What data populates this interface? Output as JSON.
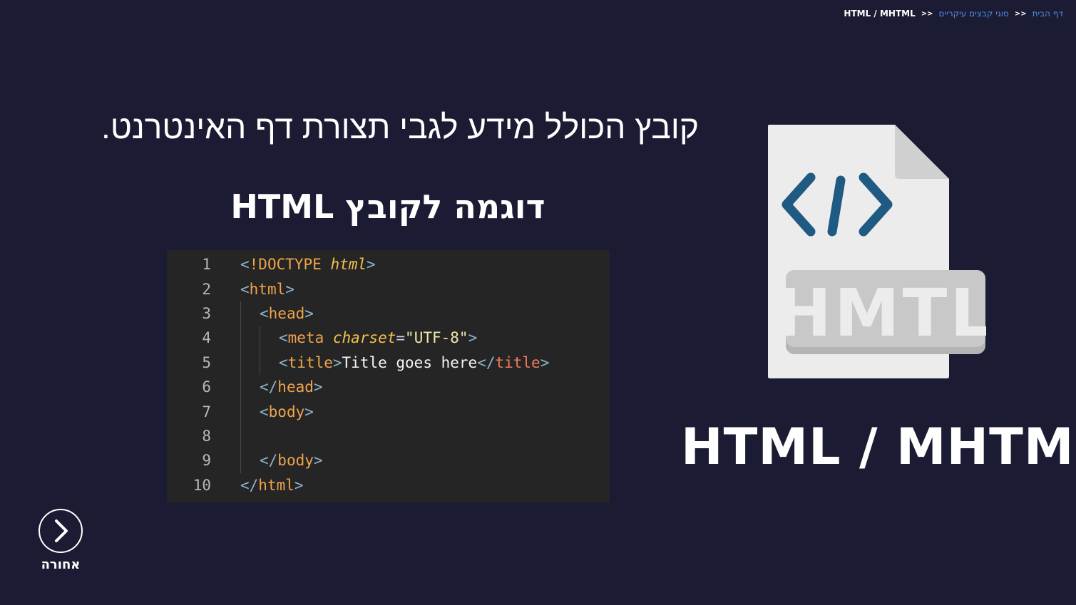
{
  "breadcrumb": {
    "home": "דף הבית",
    "category": "סוגי קבצים עיקריים",
    "current": "HTML / MHTML",
    "separator": "<<"
  },
  "description": "קובץ הכולל מידע לגבי תצורת דף האינטרנט.",
  "example_heading": "דוגמה לקובץ HTML",
  "code": {
    "line_numbers": [
      "1",
      "2",
      "3",
      "4",
      "5",
      "6",
      "7",
      "8",
      "9",
      "10"
    ],
    "lines": [
      {
        "indent": 0,
        "tokens": [
          {
            "c": "t-punct",
            "t": "<"
          },
          {
            "c": "t-doc",
            "t": "!DOCTYPE "
          },
          {
            "c": "t-kw",
            "t": "html"
          },
          {
            "c": "t-punct",
            "t": ">"
          }
        ]
      },
      {
        "indent": 0,
        "tokens": [
          {
            "c": "t-punct",
            "t": "<"
          },
          {
            "c": "t-tag",
            "t": "html"
          },
          {
            "c": "t-punct",
            "t": ">"
          }
        ]
      },
      {
        "indent": 1,
        "tokens": [
          {
            "c": "t-punct",
            "t": "<"
          },
          {
            "c": "t-tag",
            "t": "head"
          },
          {
            "c": "t-punct",
            "t": ">"
          }
        ]
      },
      {
        "indent": 2,
        "tokens": [
          {
            "c": "t-punct",
            "t": "<"
          },
          {
            "c": "t-tag",
            "t": "meta "
          },
          {
            "c": "t-attr",
            "t": "charset"
          },
          {
            "c": "t-eq",
            "t": "="
          },
          {
            "c": "t-str",
            "t": "\"UTF-8\""
          },
          {
            "c": "t-punct",
            "t": ">"
          }
        ]
      },
      {
        "indent": 2,
        "tokens": [
          {
            "c": "t-punct",
            "t": "<"
          },
          {
            "c": "t-tag",
            "t": "title"
          },
          {
            "c": "t-punct",
            "t": ">"
          },
          {
            "c": "t-text",
            "t": "Title goes here"
          },
          {
            "c": "t-punct",
            "t": "</"
          },
          {
            "c": "t-title-close",
            "t": "title"
          },
          {
            "c": "t-punct",
            "t": ">"
          }
        ]
      },
      {
        "indent": 1,
        "tokens": [
          {
            "c": "t-punct",
            "t": "</"
          },
          {
            "c": "t-closetag",
            "t": "head"
          },
          {
            "c": "t-punct",
            "t": ">"
          }
        ]
      },
      {
        "indent": 1,
        "tokens": [
          {
            "c": "t-punct",
            "t": "<"
          },
          {
            "c": "t-tag",
            "t": "body"
          },
          {
            "c": "t-punct",
            "t": ">"
          }
        ]
      },
      {
        "indent": 1,
        "tokens": []
      },
      {
        "indent": 1,
        "tokens": [
          {
            "c": "t-punct",
            "t": "</"
          },
          {
            "c": "t-closetag",
            "t": "body"
          },
          {
            "c": "t-punct",
            "t": ">"
          }
        ]
      },
      {
        "indent": 0,
        "tokens": [
          {
            "c": "t-punct",
            "t": "</"
          },
          {
            "c": "t-closetag",
            "t": "html"
          },
          {
            "c": "t-punct",
            "t": ">"
          }
        ]
      }
    ]
  },
  "file_icon": {
    "name": "html-file-icon",
    "label": "HMTL",
    "code_symbol": "</>",
    "page_color": "#ececec",
    "fold_color": "#d0d0d0",
    "badge_color": "#c8c8c8",
    "symbol_color": "#1e5a82"
  },
  "big_title": "HTML / MHTML",
  "back_button": {
    "label": "אחורה",
    "icon": "chevron-right-icon"
  },
  "colors": {
    "background": "#1b1c33",
    "link": "#4d8de6",
    "code_bg": "#252526"
  }
}
